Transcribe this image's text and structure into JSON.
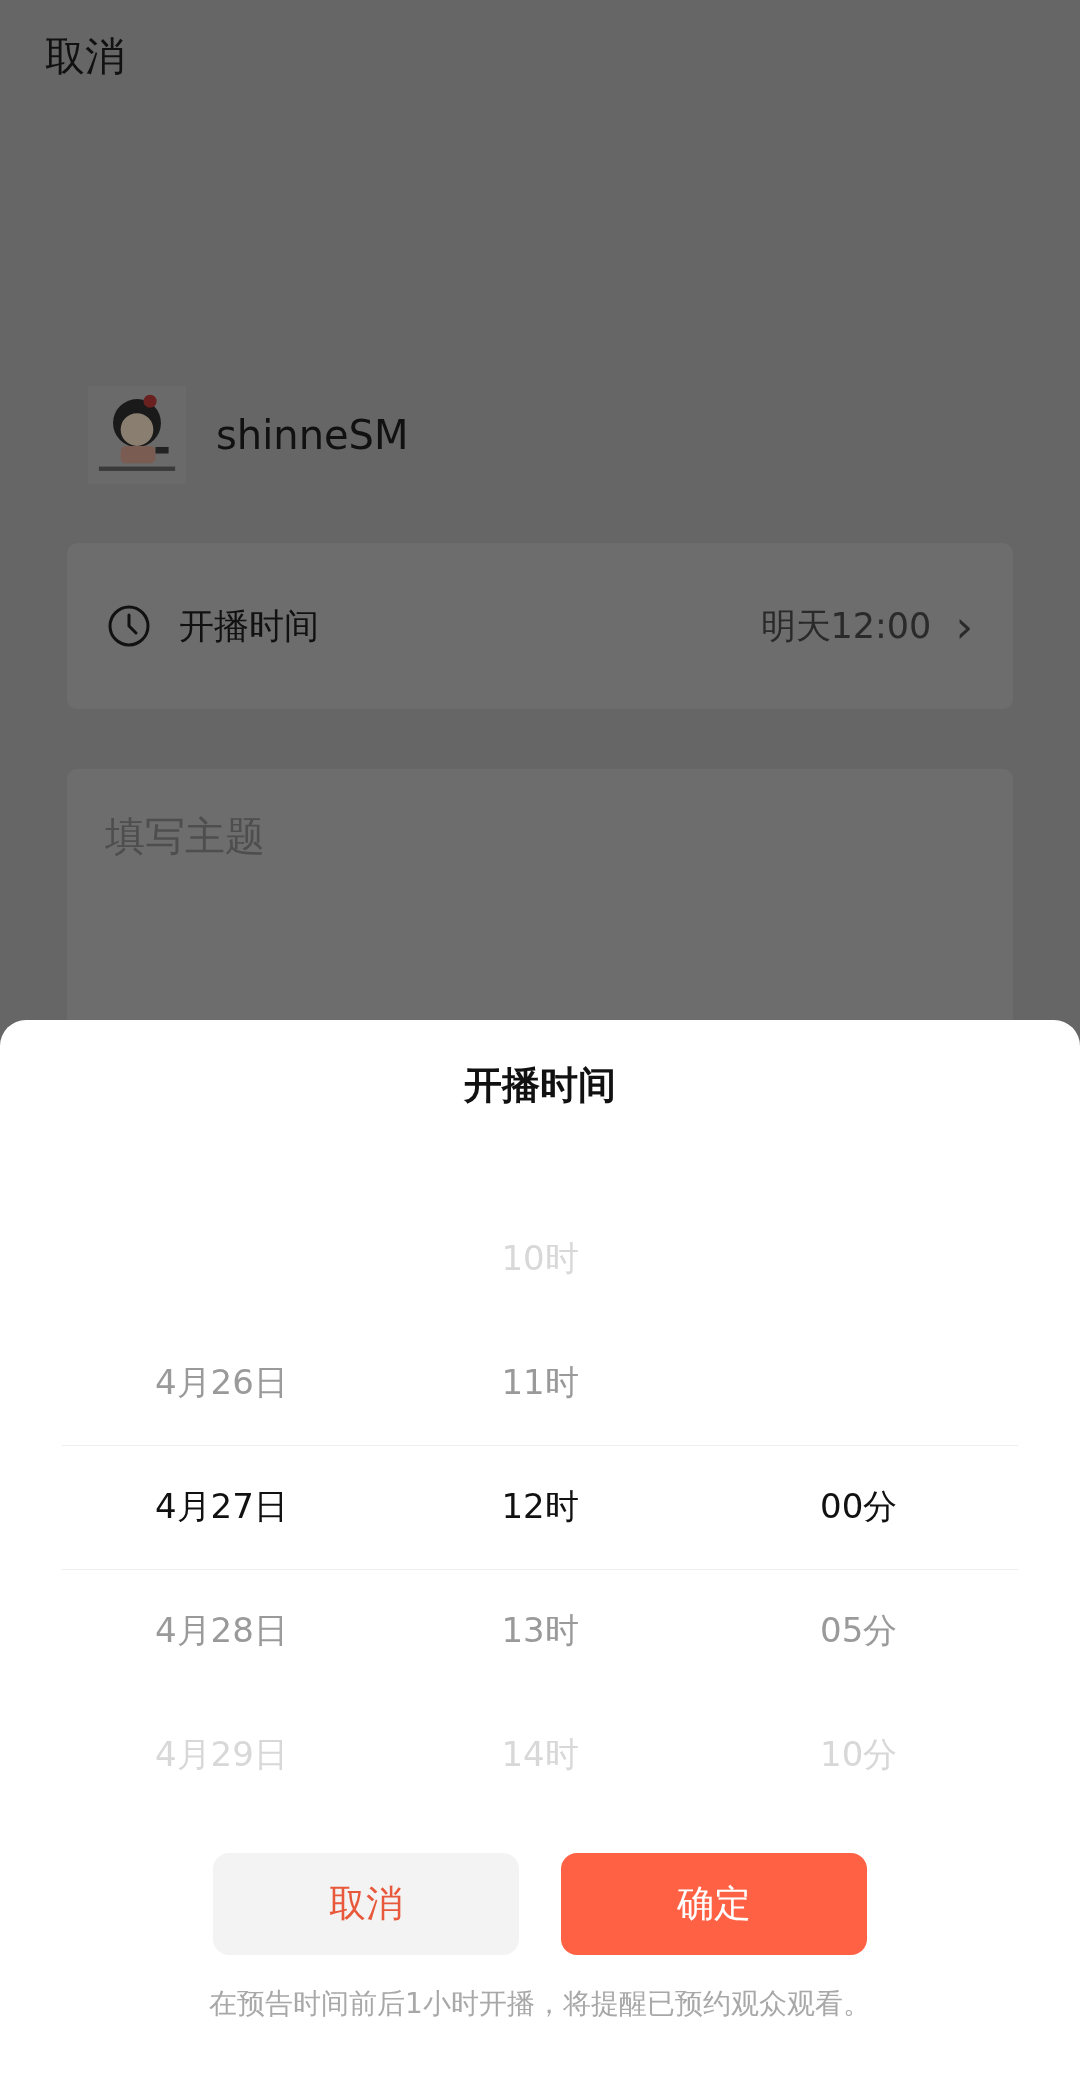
{
  "top_bar": {
    "cancel": "取消"
  },
  "profile": {
    "name": "shinneSM"
  },
  "start_time_row": {
    "label": "开播时间",
    "value": "明天12:00",
    "chevron": "›"
  },
  "topic_field": {
    "placeholder": "填写主题"
  },
  "time_sheet": {
    "title": "开播时间",
    "columns": [
      {
        "items": [
          {
            "label": "4月26日",
            "selected": false
          },
          {
            "label": "4月27日",
            "selected": true
          },
          {
            "label": "4月28日",
            "selected": false
          },
          {
            "label": "4月29日",
            "selected": false
          }
        ]
      },
      {
        "items": [
          {
            "label": "10时",
            "selected": false
          },
          {
            "label": "11时",
            "selected": false
          },
          {
            "label": "12时",
            "selected": true
          },
          {
            "label": "13时",
            "selected": false
          },
          {
            "label": "14时",
            "selected": false
          }
        ]
      },
      {
        "items": [
          {
            "label": "00分",
            "selected": true
          },
          {
            "label": "05分",
            "selected": false
          },
          {
            "label": "10分",
            "selected": false
          }
        ]
      }
    ],
    "buttons": [
      {
        "label": "取消",
        "kind": "secondary"
      },
      {
        "label": "确定",
        "kind": "primary"
      }
    ],
    "note": "在预告时间前后1小时开播，将提醒已预约观众观看。"
  }
}
